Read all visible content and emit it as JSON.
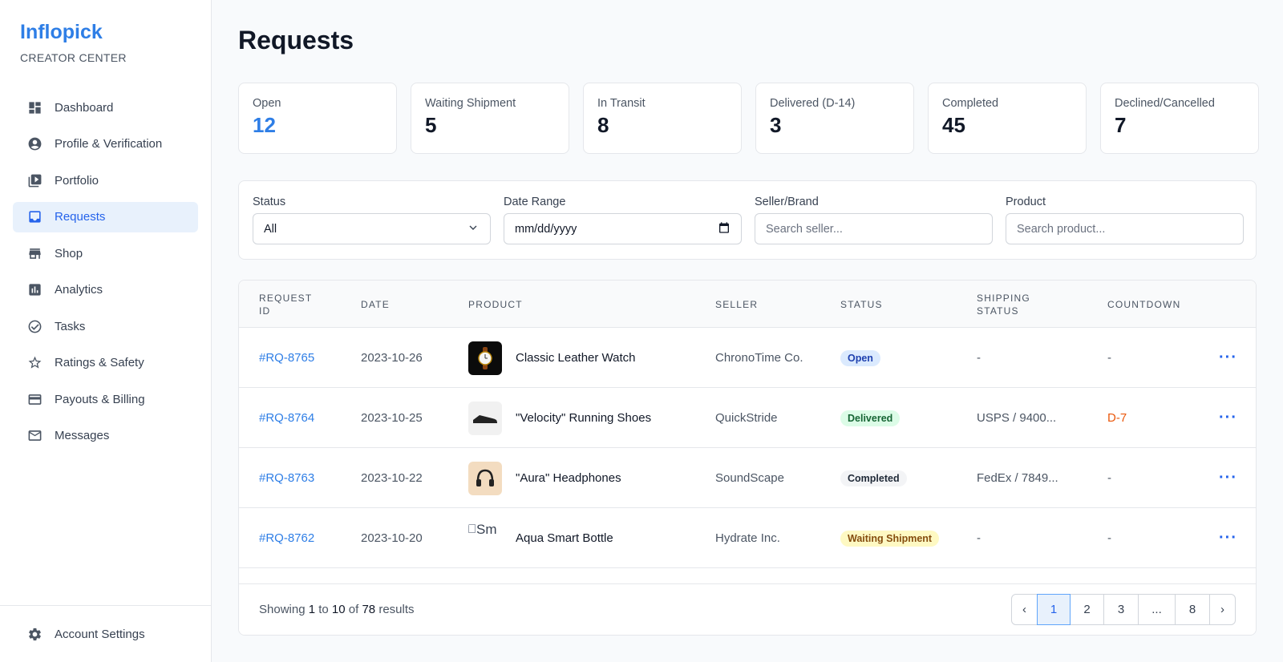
{
  "app": {
    "brand": "Inflopick",
    "subtitle": "CREATOR CENTER"
  },
  "sidebar": {
    "items": [
      {
        "label": "Dashboard",
        "icon": "dashboard-icon"
      },
      {
        "label": "Profile & Verification",
        "icon": "account-circle-icon"
      },
      {
        "label": "Portfolio",
        "icon": "video-library-icon"
      },
      {
        "label": "Requests",
        "icon": "inbox-icon",
        "active": true
      },
      {
        "label": "Shop",
        "icon": "store-icon"
      },
      {
        "label": "Analytics",
        "icon": "analytics-icon"
      },
      {
        "label": "Tasks",
        "icon": "task-check-icon"
      },
      {
        "label": "Ratings & Safety",
        "icon": "star-icon"
      },
      {
        "label": "Payouts & Billing",
        "icon": "credit-card-icon"
      },
      {
        "label": "Messages",
        "icon": "mail-icon"
      }
    ],
    "footer": {
      "label": "Account Settings",
      "icon": "gear-icon"
    }
  },
  "page": {
    "title": "Requests"
  },
  "stats": [
    {
      "label": "Open",
      "value": "12"
    },
    {
      "label": "Waiting Shipment",
      "value": "5"
    },
    {
      "label": "In Transit",
      "value": "8"
    },
    {
      "label": "Delivered (D-14)",
      "value": "3"
    },
    {
      "label": "Completed",
      "value": "45"
    },
    {
      "label": "Declined/Cancelled",
      "value": "7"
    }
  ],
  "filters": {
    "status": {
      "label": "Status",
      "value": "All"
    },
    "date": {
      "label": "Date Range",
      "placeholder": "mm/dd/yyyy"
    },
    "seller": {
      "label": "Seller/Brand",
      "placeholder": "Search seller..."
    },
    "product": {
      "label": "Product",
      "placeholder": "Search product..."
    }
  },
  "table": {
    "headers": [
      "REQUEST ID",
      "DATE",
      "PRODUCT",
      "SELLER",
      "STATUS",
      "SHIPPING STATUS",
      "COUNTDOWN"
    ],
    "rows": [
      {
        "id": "#RQ-8765",
        "date": "2023-10-26",
        "product": "Classic Leather Watch",
        "seller": "ChronoTime Co.",
        "status": "Open",
        "shipping": "-",
        "countdown": "-"
      },
      {
        "id": "#RQ-8764",
        "date": "2023-10-25",
        "product": "\"Velocity\" Running Shoes",
        "seller": "QuickStride",
        "status": "Delivered",
        "shipping": "USPS / 9400...",
        "countdown": "D-7"
      },
      {
        "id": "#RQ-8763",
        "date": "2023-10-22",
        "product": "\"Aura\" Headphones",
        "seller": "SoundScape",
        "status": "Completed",
        "shipping": "FedEx / 7849...",
        "countdown": "-"
      },
      {
        "id": "#RQ-8762",
        "date": "2023-10-20",
        "product": "Aqua Smart Bottle",
        "seller": "Hydrate Inc.",
        "status": "Waiting Shipment",
        "shipping": "-",
        "countdown": "-",
        "thumb_alt": "Sm"
      }
    ],
    "more_label": "···"
  },
  "footer": {
    "showing_prefix": "Showing",
    "from": "1",
    "to_word": "to",
    "to": "10",
    "of_word": "of",
    "total": "78",
    "suffix": "results"
  },
  "pagination": {
    "prev": "‹",
    "pages": [
      "1",
      "2",
      "3",
      "...",
      "8"
    ],
    "next": "›",
    "current": "1"
  },
  "colors": {
    "accent": "#2e7ee6",
    "warn": "#ea580c"
  }
}
